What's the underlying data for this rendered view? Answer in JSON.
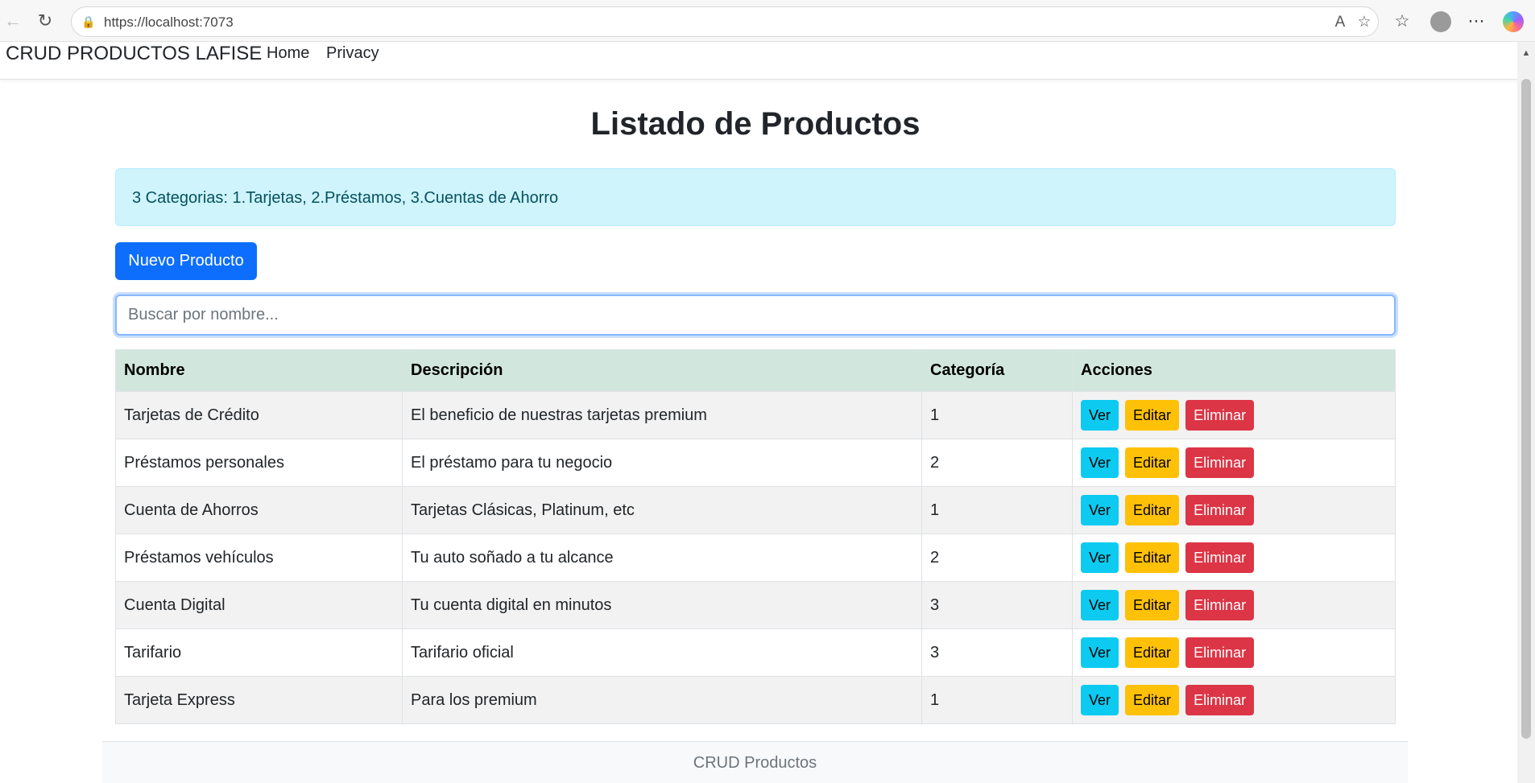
{
  "browser": {
    "url": "https://localhost:7073",
    "icons": [
      "back-icon",
      "reload-icon",
      "lock-icon",
      "read-aloud-icon",
      "favorite-star-icon",
      "favorites-icon",
      "profile-icon",
      "more-icon",
      "copilot-icon"
    ]
  },
  "navbar": {
    "brand": "CRUD PRODUCTOS LAFISE",
    "links": [
      {
        "label": "Home"
      },
      {
        "label": "Privacy"
      }
    ]
  },
  "main": {
    "title": "Listado de Productos",
    "alert": "3 Categorias: 1.Tarjetas, 2.Préstamos, 3.Cuentas de Ahorro",
    "new_button": "Nuevo Producto",
    "search_placeholder": "Buscar por nombre..."
  },
  "table": {
    "headers": [
      "Nombre",
      "Descripción",
      "Categoría",
      "Acciones"
    ],
    "actions": {
      "view": "Ver",
      "edit": "Editar",
      "delete": "Eliminar"
    },
    "rows": [
      {
        "nombre": "Tarjetas de Crédito",
        "descripcion": "El beneficio de nuestras tarjetas premium",
        "categoria": "1"
      },
      {
        "nombre": "Préstamos personales",
        "descripcion": "El préstamo para tu negocio",
        "categoria": "2"
      },
      {
        "nombre": "Cuenta de Ahorros",
        "descripcion": "Tarjetas Clásicas, Platinum, etc",
        "categoria": "1"
      },
      {
        "nombre": "Préstamos vehículos",
        "descripcion": "Tu auto soñado a tu alcance",
        "categoria": "2"
      },
      {
        "nombre": "Cuenta Digital",
        "descripcion": "Tu cuenta digital en minutos",
        "categoria": "3"
      },
      {
        "nombre": "Tarifario",
        "descripcion": "Tarifario oficial",
        "categoria": "3"
      },
      {
        "nombre": "Tarjeta Express",
        "descripcion": "Para los premium",
        "categoria": "1"
      }
    ]
  },
  "footer": {
    "text": "CRUD Productos"
  },
  "colors": {
    "primary": "#0d6efd",
    "info": "#0dcaf0",
    "warning": "#ffc107",
    "danger": "#dc3545",
    "alert_bg": "#cff4fc",
    "table_header_bg": "#d1e7dd"
  }
}
